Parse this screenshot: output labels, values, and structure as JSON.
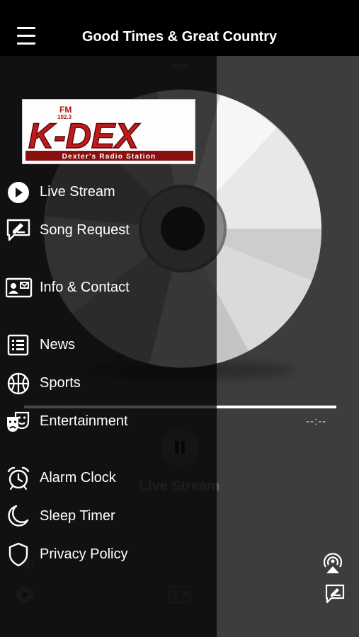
{
  "header": {
    "title": "Good Times & Great Country"
  },
  "logo": {
    "fm": "FM",
    "freq": "102.3",
    "name": "K-DEX",
    "tagline": "Dexter's Radio Station"
  },
  "menu": {
    "live_stream": "Live Stream",
    "song_request": "Song Request",
    "info_contact": "Info & Contact",
    "news": "News",
    "sports": "Sports",
    "entertainment": "Entertainment",
    "alarm_clock": "Alarm Clock",
    "sleep_timer": "Sleep Timer",
    "privacy_policy": "Privacy Policy"
  },
  "player": {
    "elapsed": "-",
    "remaining": "--:--",
    "now_playing": "Live Stream"
  },
  "colors": {
    "topbar": "#000000",
    "player_bg": "#3d3d3d",
    "drawer_overlay": "#000000",
    "logo_red": "#c21a1a"
  },
  "icons": [
    "menu-icon",
    "play-circle-icon",
    "request-icon",
    "contact-card-icon",
    "news-list-icon",
    "basketball-icon",
    "theater-masks-icon",
    "alarm-clock-icon",
    "moon-icon",
    "shield-icon",
    "pause-icon",
    "volume-icon",
    "airplay-icon"
  ]
}
